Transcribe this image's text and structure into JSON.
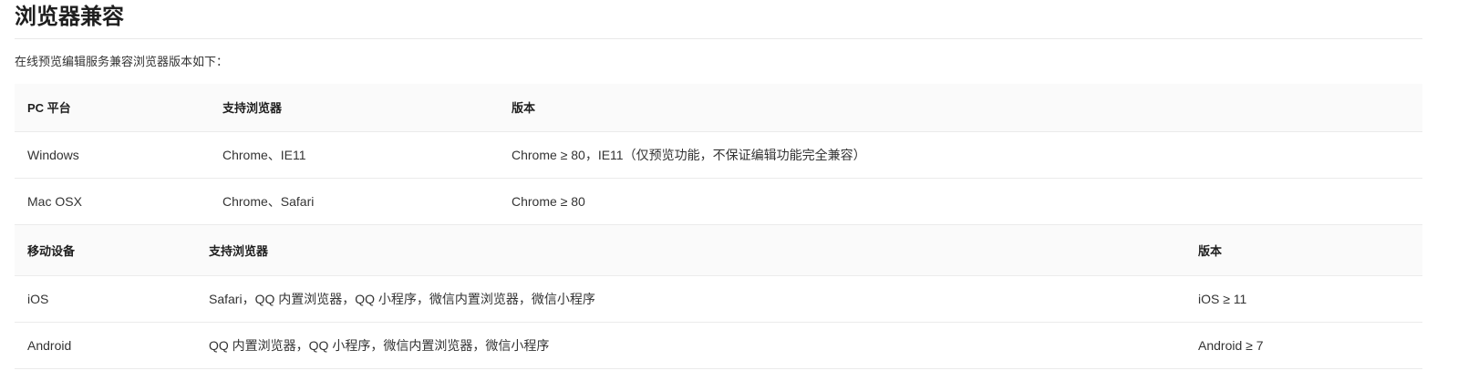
{
  "page": {
    "title": "浏览器兼容",
    "intro": "在线预览编辑服务兼容浏览器版本如下："
  },
  "pc_table": {
    "headers": [
      "PC 平台",
      "支持浏览器",
      "版本"
    ],
    "rows": [
      [
        "Windows",
        "Chrome、IE11",
        "Chrome ≥ 80，IE11（仅预览功能，不保证编辑功能完全兼容）"
      ],
      [
        "Mac OSX",
        "Chrome、Safari",
        "Chrome ≥ 80"
      ]
    ]
  },
  "mobile_table": {
    "headers": [
      "移动设备",
      "支持浏览器",
      "版本"
    ],
    "rows": [
      [
        "iOS",
        "Safari，QQ 内置浏览器，QQ 小程序，微信内置浏览器，微信小程序",
        "iOS ≥ 11"
      ],
      [
        "Android",
        "QQ 内置浏览器，QQ 小程序，微信内置浏览器，微信小程序",
        "Android ≥ 7"
      ]
    ]
  },
  "theme": {
    "text": "#333333",
    "heading": "#1f1f1f",
    "header_bg": "#fafafa",
    "border": "#ebebeb",
    "divider": "#e8e8e8"
  }
}
